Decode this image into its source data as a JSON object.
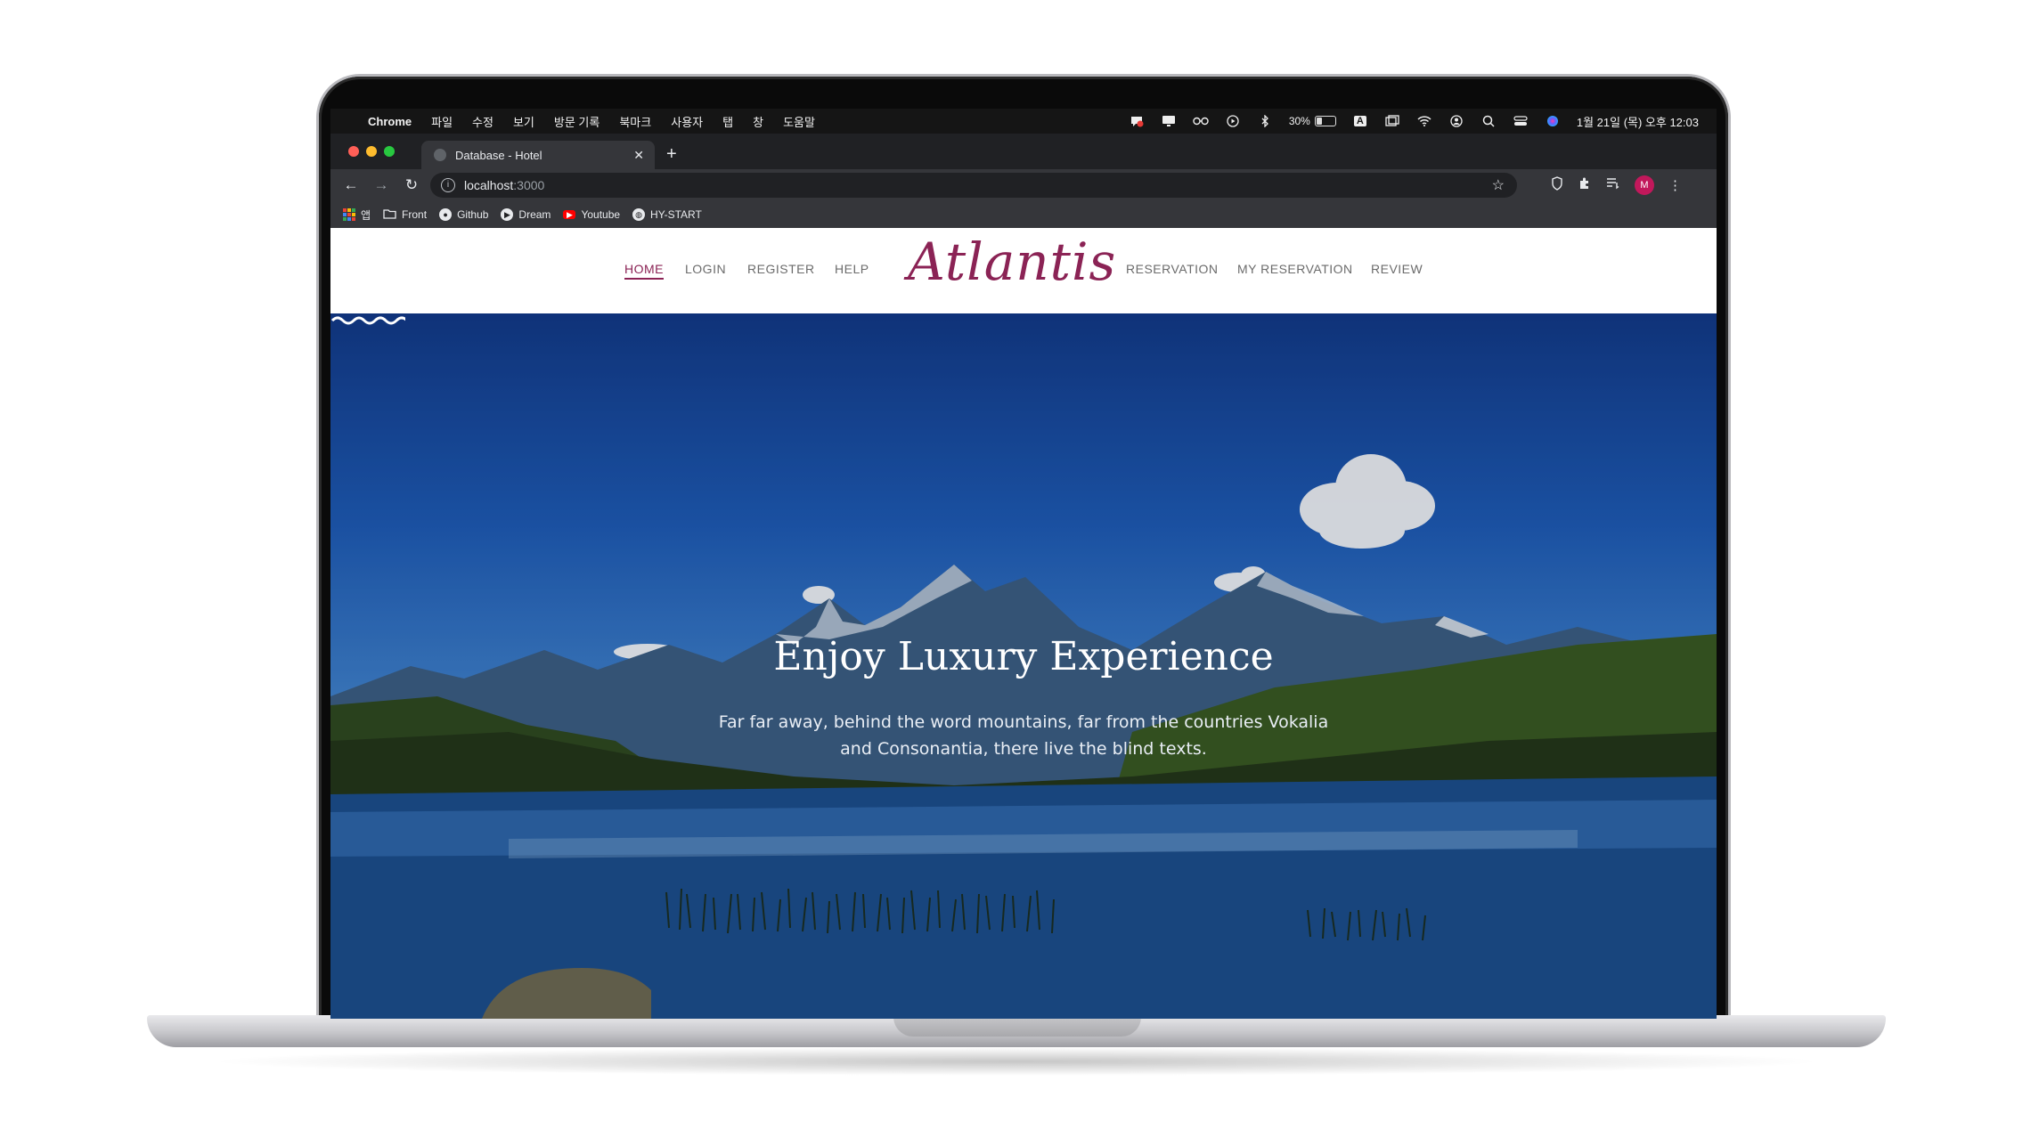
{
  "menubar": {
    "app": "Chrome",
    "menus": [
      "파일",
      "수정",
      "보기",
      "방문 기록",
      "북마크",
      "사용자",
      "탭",
      "창",
      "도움말"
    ],
    "battery": "30%",
    "battery_level": 0.3,
    "ime": "A",
    "datetime": "1월 21일 (목) 오후 12:03"
  },
  "browser": {
    "tab_title": "Database - Hotel",
    "url_host": "localhost",
    "url_port": ":3000",
    "profile_initial": "M",
    "bookmarks": [
      "앱",
      "Front",
      "Github",
      "Dream",
      "Youtube",
      "HY-START"
    ]
  },
  "site": {
    "logo": "Atlantis",
    "nav_left": [
      "HOME",
      "LOGIN",
      "REGISTER",
      "HELP"
    ],
    "nav_right": [
      "RESERVATION",
      "MY RESERVATION",
      "REVIEW"
    ],
    "hero_title": "Enjoy Luxury Experience",
    "hero_subtitle": "Far far away, behind the word mountains, far from the countries Vokalia and Consonantia, there live the blind texts.",
    "accent": "#8b2355"
  },
  "icons": {
    "apple": "apple-icon",
    "close": "close-icon",
    "new_tab": "plus-icon",
    "back": "arrow-left-icon",
    "forward": "arrow-right-icon",
    "reload": "reload-icon",
    "star": "star-icon",
    "extensions": "puzzle-icon"
  }
}
